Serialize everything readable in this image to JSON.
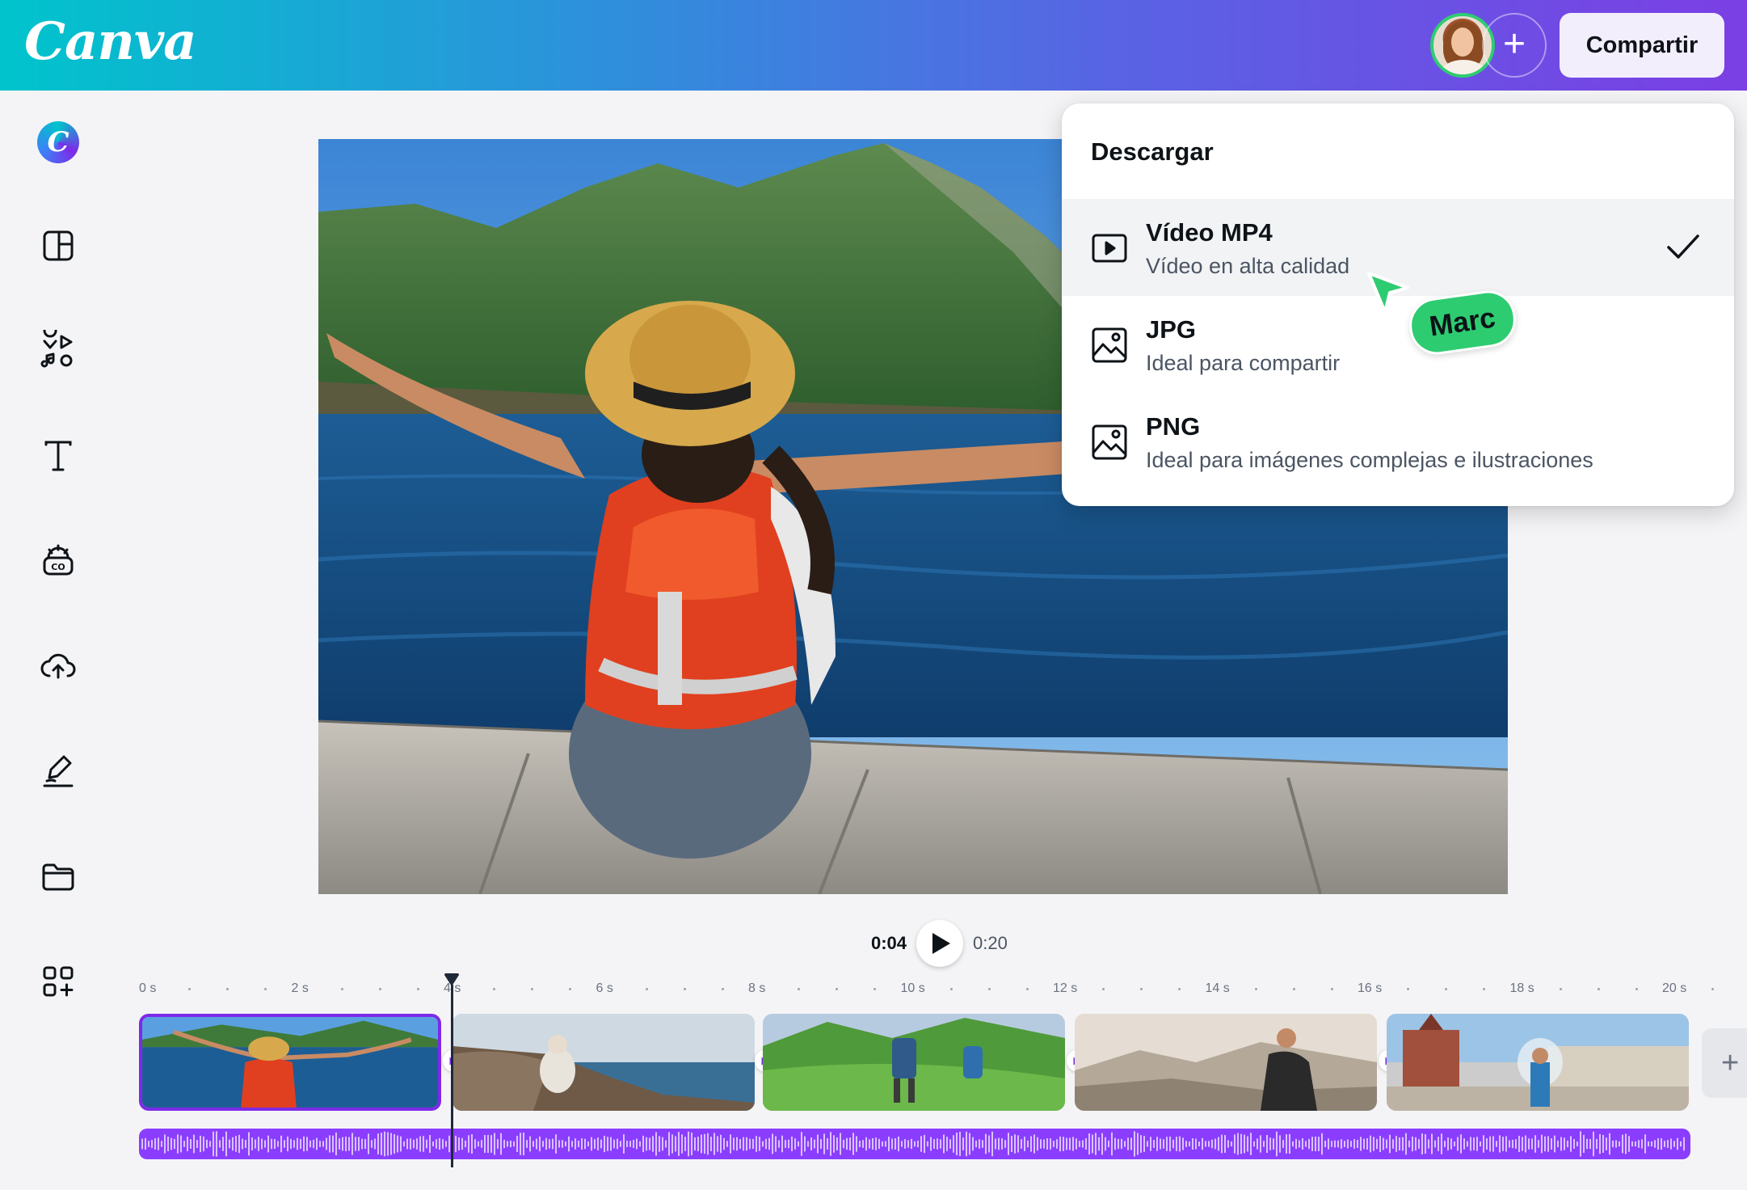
{
  "header": {
    "logo": "Canva",
    "add_icon": "plus-icon",
    "share_label": "Compartir"
  },
  "sidebar": {
    "magic_glyph": "C",
    "items": [
      {
        "icon": "design-layout-icon"
      },
      {
        "icon": "elements-icon"
      },
      {
        "icon": "text-icon"
      },
      {
        "icon": "brand-kit-icon"
      },
      {
        "icon": "uploads-icon"
      },
      {
        "icon": "draw-icon"
      },
      {
        "icon": "projects-folder-icon"
      },
      {
        "icon": "apps-icon"
      }
    ]
  },
  "download_menu": {
    "title": "Descargar",
    "options": [
      {
        "name": "Vídeo MP4",
        "description": "Vídeo en alta calidad",
        "icon": "video-icon",
        "selected": true
      },
      {
        "name": "JPG",
        "description": "Ideal para compartir",
        "icon": "image-icon",
        "selected": false
      },
      {
        "name": "PNG",
        "description": "Ideal para imágenes complejas e ilustraciones",
        "icon": "image-icon",
        "selected": false
      }
    ]
  },
  "collaborator": {
    "name": "Marc",
    "color": "#2ecc71"
  },
  "playback": {
    "current": "0:04",
    "total": "0:20"
  },
  "timeline": {
    "ruler_labels": [
      "0 s",
      "2 s",
      "4 s",
      "6 s",
      "8 s",
      "10 s",
      "12 s",
      "14 s",
      "16 s",
      "18 s",
      "20 s"
    ],
    "clips": [
      {
        "name": "clip-lake-traveler",
        "selected": true
      },
      {
        "name": "clip-coast-sitting",
        "selected": false
      },
      {
        "name": "clip-hikers-green",
        "selected": false
      },
      {
        "name": "clip-mountain-man",
        "selected": false
      },
      {
        "name": "clip-city-square",
        "selected": false
      }
    ],
    "add_label": "+"
  },
  "colors": {
    "accent": "#7d2ae8",
    "audio": "#8b3dff",
    "header_start": "#00c4cc",
    "header_end": "#7b3fe4"
  }
}
